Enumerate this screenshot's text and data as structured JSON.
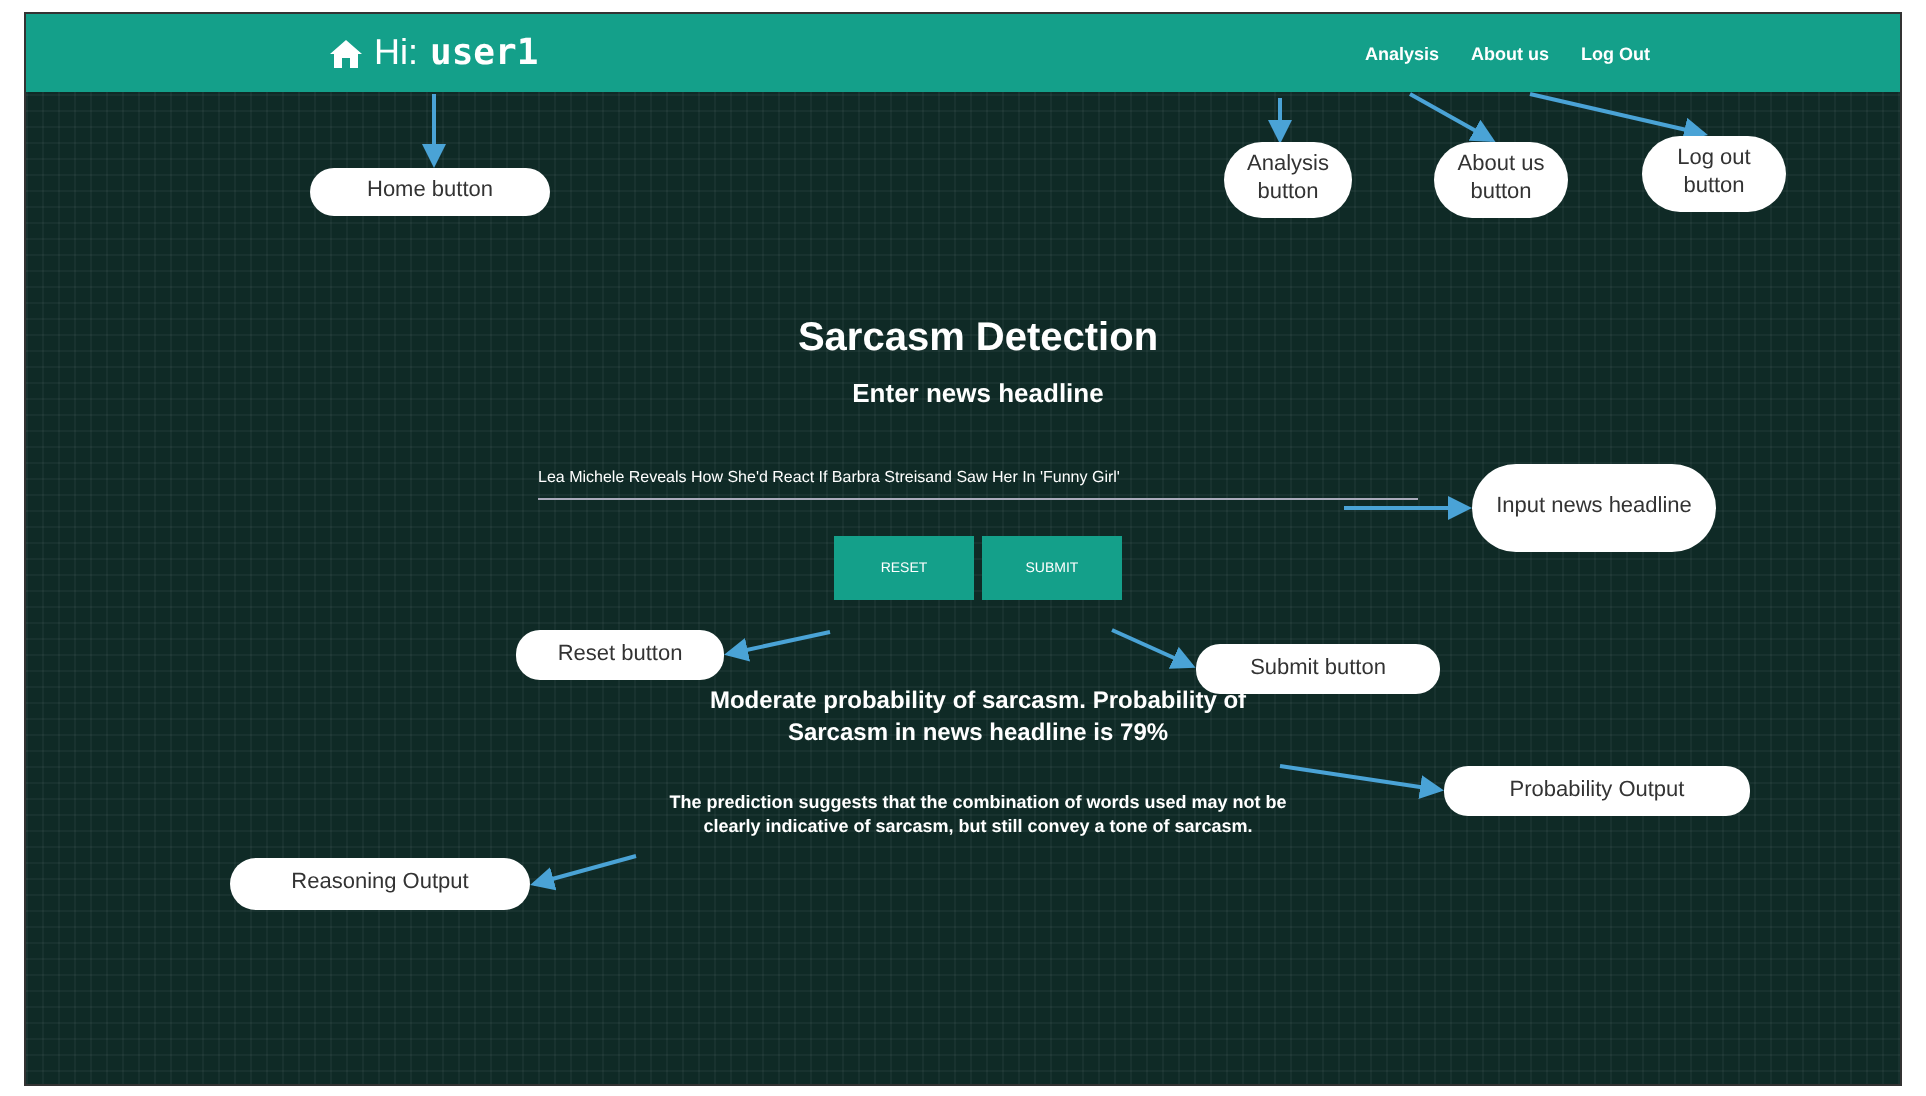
{
  "header": {
    "greeting": "Hi:",
    "username": "user1",
    "nav": [
      {
        "label": "Analysis"
      },
      {
        "label": "About us"
      },
      {
        "label": "Log Out"
      }
    ]
  },
  "form": {
    "title": "Sarcasm Detection",
    "subtitle": "Enter news headline",
    "headline_value": "Lea Michele Reveals How She'd React If Barbra Streisand Saw Her In 'Funny Girl'",
    "buttons": [
      {
        "label": "RESET"
      },
      {
        "label": "SUBMIT"
      }
    ]
  },
  "result": {
    "probability": "Moderate probability of sarcasm. Probability of Sarcasm in news headline is 79%",
    "reasoning": "The prediction suggests that the combination of words used may not be clearly indicative of sarcasm, but still convey a tone of sarcasm."
  },
  "annotations": [
    {
      "text": "Home button"
    },
    {
      "text": "Analysis button"
    },
    {
      "text": "About us button"
    },
    {
      "text": "Log out button"
    },
    {
      "text": "Input news headline"
    },
    {
      "text": "Reset button"
    },
    {
      "text": "Submit button"
    },
    {
      "text": "Probability Output"
    },
    {
      "text": "Reasoning Output"
    }
  ]
}
